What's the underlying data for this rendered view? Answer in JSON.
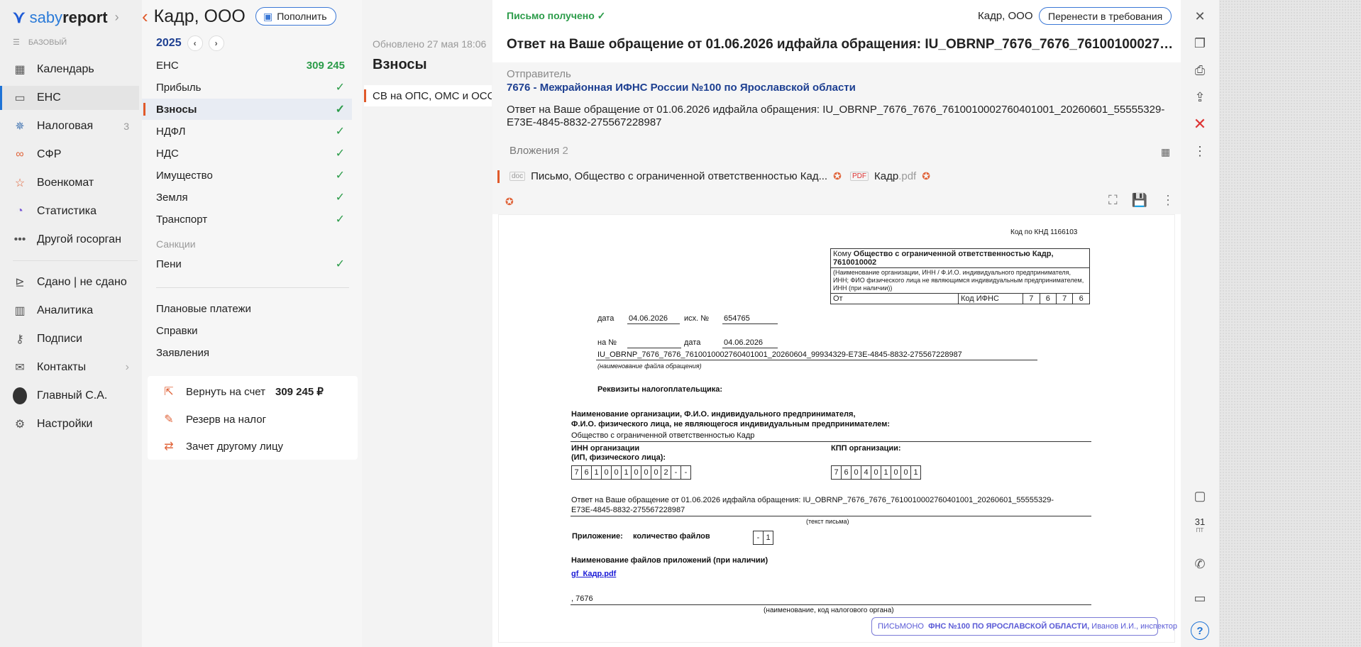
{
  "nav": {
    "logo_a": "saby",
    "logo_b": "report",
    "plan": "БАЗОВЫЙ",
    "items": [
      {
        "label": "Календарь",
        "icon": "calendar-icon"
      },
      {
        "label": "ЕНС",
        "icon": "wallet-icon",
        "active": true
      },
      {
        "label": "Налоговая",
        "icon": "emblem-icon",
        "count": "3"
      },
      {
        "label": "СФР",
        "icon": "sfr-icon"
      },
      {
        "label": "Военкомат",
        "icon": "star-icon"
      },
      {
        "label": "Статистика",
        "icon": "pie-icon"
      },
      {
        "label": "Другой госорган",
        "icon": "more-icon"
      },
      {
        "label": "Сдано | не сдано",
        "icon": "done-icon"
      },
      {
        "label": "Аналитика",
        "icon": "bars-icon"
      },
      {
        "label": "Подписи",
        "icon": "key-icon"
      },
      {
        "label": "Контакты",
        "icon": "contacts-icon"
      },
      {
        "label": "Главный С.А.",
        "icon": "avatar"
      },
      {
        "label": "Настройки",
        "icon": "gear-icon"
      }
    ]
  },
  "header": {
    "title": "Кадр, ООО",
    "topup": "Пополнить"
  },
  "year": "2025",
  "taxes": [
    {
      "label": "ЕНС",
      "value": "309 245"
    },
    {
      "label": "Прибыль"
    },
    {
      "label": "Взносы",
      "selected": true
    },
    {
      "label": "НДФЛ"
    },
    {
      "label": "НДС"
    },
    {
      "label": "Имущество"
    },
    {
      "label": "Земля"
    },
    {
      "label": "Транспорт"
    }
  ],
  "sanctions_label": "Санкции",
  "peni": "Пени",
  "check": "✓",
  "links": [
    "Плановые платежи",
    "Справки",
    "Заявления"
  ],
  "card": {
    "return_label": "Вернуть на счет",
    "return_amount": "309 245 ₽",
    "reserve": "Резерв на налог",
    "offset": "Зачет другому лицу"
  },
  "middle": {
    "updated": "Обновлено 27 мая 18:06",
    "title": "Взносы",
    "row": "СВ на ОПС, ОМС и ОСС"
  },
  "letter": {
    "status": "Письмо получено ✓",
    "org": "Кадр, ООО",
    "transfer": "Перенести в требования",
    "subject": "Ответ на Ваше обращение от 01.06.2026 идфайла обращения: IU_OBRNP_7676_7676_761001000276040...",
    "sender_label": "Отправитель",
    "sender": "7676 - Межрайонная ИФНС России №100 по Ярославской области",
    "body": "Ответ на Ваше обращение от 01.06.2026 идфайла обращения: IU_OBRNP_7676_7676_7610010002760401001_20260601_55555329-E73E-4845-8832-275567228987",
    "attachments_label": "Вложения",
    "attachments_count": "2",
    "file1": "Письмо, Общество с ограниченной ответственностью Кад...",
    "file2_name": "Кадр",
    "file2_ext": ".pdf"
  },
  "doc": {
    "knd": "Код по КНД 1166103",
    "to_label": "Кому",
    "to_value": "Общество с ограниченной ответственностью Кадр, 7610010002",
    "to_note": "(Наименование организации, ИНН / Ф.И.О. индивидуального предпринимателя, ИНН; ФИО физического лица не являющимся индивидуальным предпринимателем, ИНН (при наличии))",
    "from_label": "От",
    "ifns_label": "Код ИФНС",
    "ifns_digits": [
      "7",
      "6",
      "7",
      "6"
    ],
    "date_label": "дата",
    "date_value": "04.06.2026",
    "out_label": "исх. №",
    "out_value": "654765",
    "na_label": "на №",
    "date2_label": "дата",
    "date2_value": "04.06.2026",
    "file_id": "IU_OBRNP_7676_7676_7610010002760401001_20260604_99934329-E73E-4845-8832-275567228987",
    "file_note": "(наименование файла обращения)",
    "req": "Реквизиты налогоплательщика:",
    "name_label": "Наименование организации, Ф.И.О. индивидуального предпринимателя,",
    "name_label2": "Ф.И.О. физического лица, не являющегося индивидуальным предпринимателем:",
    "name_value": "Общество с ограниченной ответственностью Кадр",
    "inn_label": "ИНН организации",
    "inn_label2": "(ИП, физического лица):",
    "inn_digits": [
      "7",
      "6",
      "1",
      "0",
      "0",
      "1",
      "0",
      "0",
      "0",
      "2",
      "-",
      "-"
    ],
    "kpp_label": "КПП организации:",
    "kpp_digits": [
      "7",
      "6",
      "0",
      "4",
      "0",
      "1",
      "0",
      "0",
      "1"
    ],
    "text": "Ответ на Ваше обращение от 01.06.2026 идфайла обращения: IU_OBRNP_7676_7676_7610010002760401001_20260601_55555329-",
    "text2": "E73E-4845-8832-275567228987",
    "text_note": "(текст письма)",
    "app_label": "Приложение:",
    "app_count_label": "количество файлов",
    "app_digits": [
      "-",
      "1"
    ],
    "names_label": "Наименование файлов приложений (при наличии)",
    "attach_link": "gf_Кадр.pdf",
    "org_code": ", 7676",
    "org_note": "(наименование, код налогового органа)",
    "stamp_a": "ПИСЬМОНО",
    "stamp_b": "ФНС №100 ПО ЯРОСЛАВСКОЙ ОБЛАСТИ,",
    "stamp_c": "Иванов И.И., инспектор"
  },
  "calendar": {
    "day": "31",
    "wd": "ПТ"
  }
}
